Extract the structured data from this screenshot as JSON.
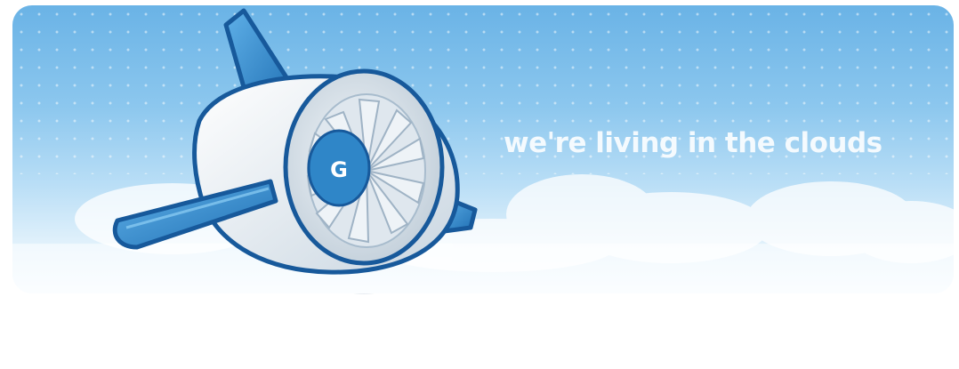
{
  "banner": {
    "tagline": "we're living in the clouds"
  },
  "illustration": {
    "subject": "jet-engine-mascot",
    "emblem": "G"
  },
  "colors": {
    "sky_top": "#6ab3e6",
    "sky_bottom": "#f6fbff",
    "mascot_blue": "#2f86c8",
    "mascot_outline": "#17599b",
    "engine_body": "#e6edf3"
  }
}
